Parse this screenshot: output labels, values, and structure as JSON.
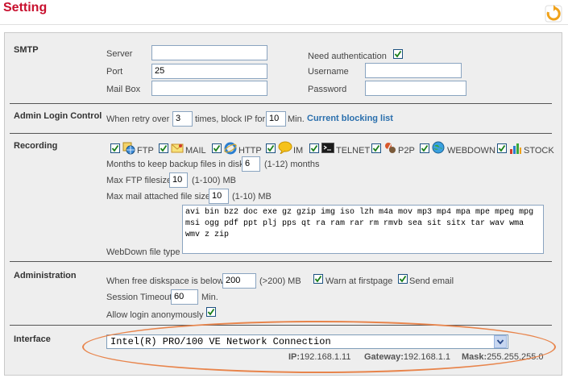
{
  "page": {
    "title": "Setting"
  },
  "smtp": {
    "section": "SMTP",
    "server_label": "Server",
    "server_value": "",
    "port_label": "Port",
    "port_value": "25",
    "mailbox_label": "Mail Box",
    "mailbox_value": "",
    "need_auth_label": "Need authentication",
    "need_auth_checked": true,
    "username_label": "Username",
    "username_value": "",
    "password_label": "Password",
    "password_value": ""
  },
  "admin": {
    "section": "Admin Login Control",
    "pre": "When retry over",
    "retry": "3",
    "mid": "times, block IP for",
    "block": "10",
    "post": "Min.",
    "link": "Current blocking list"
  },
  "recording": {
    "section": "Recording",
    "protocols": [
      {
        "label": "FTP",
        "icon": "ftp-globe-icon",
        "checked": true
      },
      {
        "label": "MAIL",
        "icon": "mail-envelope-icon",
        "checked": true
      },
      {
        "label": "HTTP",
        "icon": "http-ie-icon",
        "checked": true
      },
      {
        "label": "IM",
        "icon": "im-bubble-icon",
        "checked": true
      },
      {
        "label": "TELNET",
        "icon": "telnet-terminal-icon",
        "checked": true
      },
      {
        "label": "P2P",
        "icon": "p2p-icon",
        "checked": true
      },
      {
        "label": "WEBDOWN",
        "icon": "webdown-globe-icon",
        "checked": true
      },
      {
        "label": "STOCK",
        "icon": "stock-chart-icon",
        "checked": true
      }
    ],
    "months_pre": "Months to keep backup files in disk",
    "months_value": "6",
    "months_post": "(1-12) months",
    "ftp_pre": "Max FTP filesize",
    "ftp_value": "10",
    "ftp_post": "(1-100)  MB",
    "mail_pre": "Max mail attached file size",
    "mail_value": "10",
    "mail_post": "(1-10)  MB",
    "webdown_label": "WebDown file type",
    "webdown_types": "avi bin bz2 doc exe gz gzip img iso lzh m4a mov mp3 mp4 mpa mpe mpeg mpg msi ogg pdf ppt plj pps qt ra ram rar rm rmvb sea sit sitx tar wav wma wmv z zip"
  },
  "administration": {
    "section": "Administration",
    "disk_pre": "When free diskspace is below",
    "disk_value": "200",
    "disk_post": "(>200) MB",
    "warn_label": "Warn at firstpage",
    "warn_checked": true,
    "email_label": "Send email",
    "email_checked": true,
    "timeout_label": "Session Timeout",
    "timeout_value": "60",
    "timeout_unit": "Min.",
    "anon_label": "Allow login anonymously",
    "anon_checked": true
  },
  "interface": {
    "section": "Interface",
    "selected": "Intel(R) PRO/100 VE Network Connection",
    "ip_label": "IP:",
    "ip": "192.168.1.11",
    "gw_label": "Gateway:",
    "gw": "192.168.1.1",
    "mask_label": "Mask:",
    "mask": "255.255.255.0"
  },
  "colors": {
    "title": "#c8102e",
    "link": "#2a6fad",
    "highlight_ellipse": "#e8844b",
    "panel_bg": "#eeeeee"
  }
}
